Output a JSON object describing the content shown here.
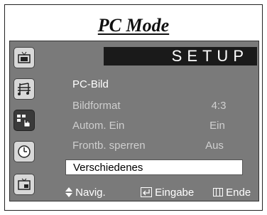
{
  "title": "PC Mode",
  "setup_label": "SETUP",
  "sidebar": {
    "icons": [
      "tv-icon",
      "music-note-icon",
      "hand-pointer-icon",
      "clock-icon",
      "pip-icon"
    ],
    "selected_index": 2
  },
  "menu": {
    "items": [
      {
        "label": "PC-Bild",
        "value": ""
      },
      {
        "label": "Bildformat",
        "value": "4:3"
      },
      {
        "label": "Autom. Ein",
        "value": "Ein"
      },
      {
        "label": "Frontb. sperren",
        "value": "Aus"
      }
    ],
    "highlighted": "Verschiedenes"
  },
  "footer": {
    "nav": "Navig.",
    "enter": "Eingabe",
    "end": "Ende"
  }
}
